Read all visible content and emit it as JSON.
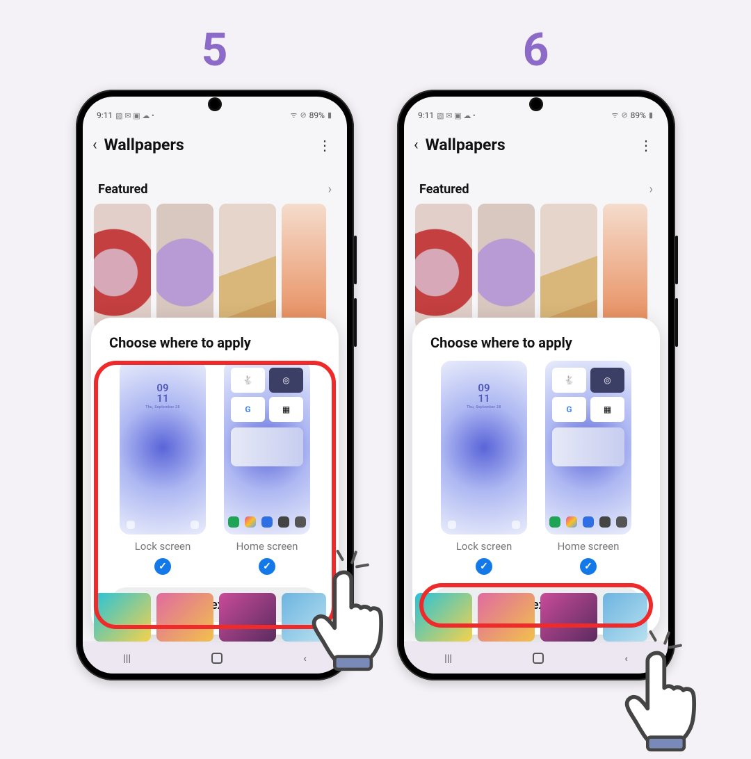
{
  "steps": {
    "left": "5",
    "right": "6"
  },
  "status": {
    "time": "9:11",
    "icons_left": "▧ ✉ ▣ ☁ •",
    "icons_right": "⊘",
    "battery": "89%"
  },
  "page": {
    "title": "Wallpapers",
    "section": "Featured"
  },
  "dialog": {
    "title": "Choose where to apply",
    "lock_clock_top": "09",
    "lock_clock_bottom": "11",
    "lock_clock_sub": "Thu, September 28",
    "option_lock": "Lock screen",
    "option_home": "Home screen",
    "next": "Next",
    "widget_g": "G"
  },
  "accent": "#8c6ac8",
  "highlight_color": "#ef2a2a"
}
